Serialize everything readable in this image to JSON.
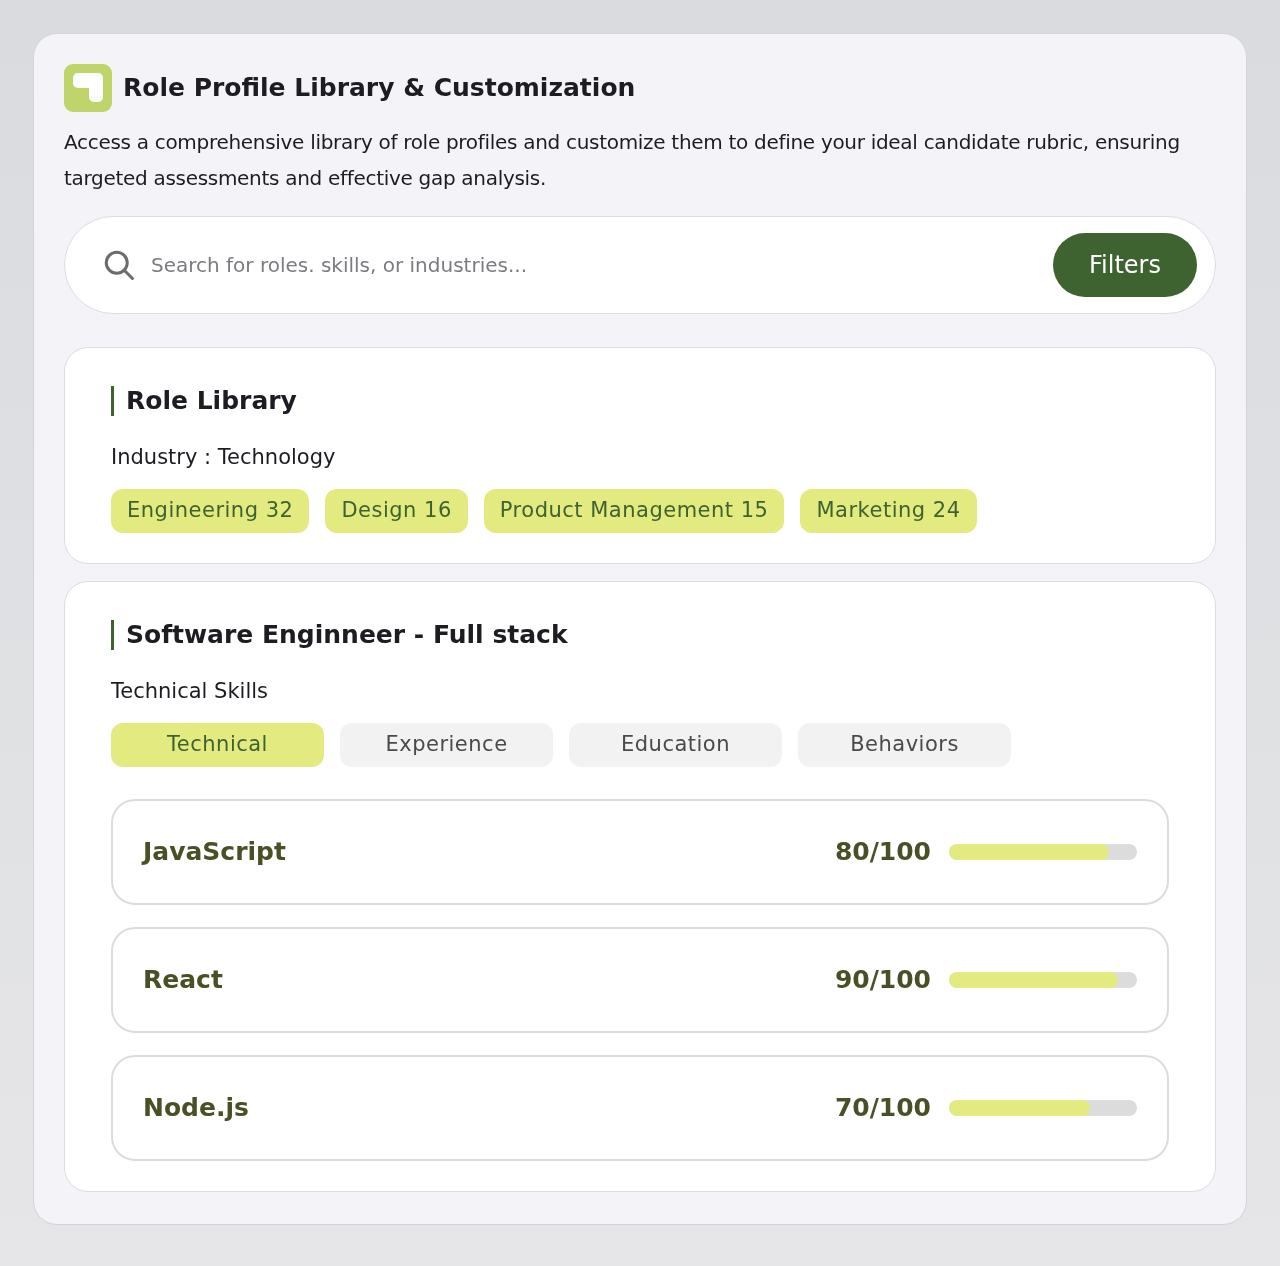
{
  "header": {
    "title": "Role Profile Library & Customization",
    "description": "Access a comprehensive library of role profiles and customize them to define your ideal candidate rubric, ensuring targeted assessments and effective gap analysis."
  },
  "search": {
    "placeholder": "Search for roles. skills, or industries...",
    "button": "Filters"
  },
  "library": {
    "title": "Role Library",
    "industry": "Industry : Technology",
    "categories": [
      {
        "label": "Engineering 32"
      },
      {
        "label": "Design 16"
      },
      {
        "label": "Product Management 15"
      },
      {
        "label": "Marketing 24"
      }
    ]
  },
  "profile": {
    "title": "Software Enginneer - Full stack",
    "subtitle": "Technical Skills",
    "tabs": [
      {
        "label": "Technical",
        "selected": true
      },
      {
        "label": "Experience",
        "selected": false
      },
      {
        "label": "Education",
        "selected": false
      },
      {
        "label": "Behaviors",
        "selected": false
      }
    ],
    "skills": [
      {
        "name": "JavaScript",
        "reading": "80/100",
        "level": 0.85
      },
      {
        "name": "React",
        "reading": "90/100",
        "level": 0.9
      },
      {
        "name": "Node.js",
        "reading": "70/100",
        "level": 0.75
      }
    ]
  }
}
